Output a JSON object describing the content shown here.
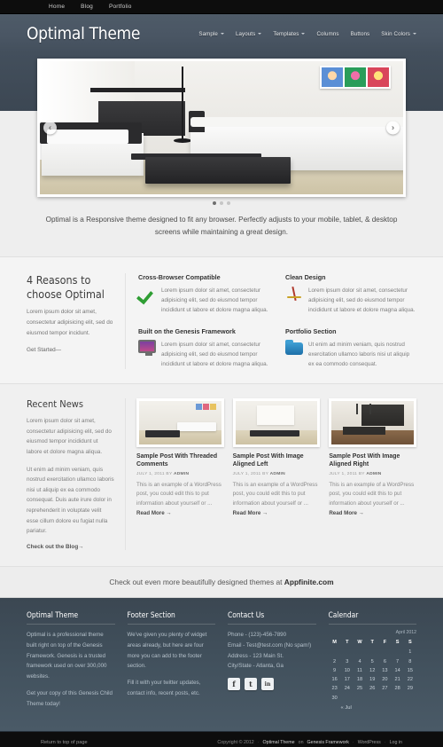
{
  "topbar": {
    "items": [
      {
        "label": "Home"
      },
      {
        "label": "Blog"
      },
      {
        "label": "Portfolio"
      }
    ]
  },
  "header": {
    "site_title": "Optimal Theme",
    "nav": [
      {
        "label": "Sample",
        "has_dropdown": true
      },
      {
        "label": "Layouts",
        "has_dropdown": true
      },
      {
        "label": "Templates",
        "has_dropdown": true
      },
      {
        "label": "Columns",
        "has_dropdown": false
      },
      {
        "label": "Buttons",
        "has_dropdown": false
      },
      {
        "label": "Skin Colors",
        "has_dropdown": true
      }
    ]
  },
  "slider": {
    "prev_icon": "chevron-left-icon",
    "next_icon": "chevron-right-icon",
    "prev_glyph": "‹",
    "next_glyph": "›",
    "slide_count": 3,
    "active_slide": 1
  },
  "tagline": "Optimal is a Responsive theme designed to fit any browser. Perfectly adjusts to your mobile, tablet, & desktop screens while maintaining a great design.",
  "features": {
    "heading": "4 Reasons to choose Optimal",
    "intro": "Lorem ipsum dolor sit amet, consectetur adipisicing elit, sed do eiusmod tempor incidunt.",
    "cta_label": "Get Started—",
    "items": [
      {
        "title": "Cross-Browser Compatible",
        "icon": "green-check-icon",
        "text": "Lorem ipsum dolor sit amet, consectetur adipisicing elit, sed do eiusmod tempor incididunt ut labore et dolore magna aliqua."
      },
      {
        "title": "Clean Design",
        "icon": "easel-icon",
        "text": "Lorem ipsum dolor sit amet, consectetur adipisicing elit, sed do eiusmod tempor incididunt ut labore et dolore magna aliqua."
      },
      {
        "title": "Built on the Genesis Framework",
        "icon": "monitor-icon",
        "text": "Lorem ipsum dolor sit amet, consectetur adipisicing elit, sed do eiusmod tempor incididunt ut labore et dolore magna aliqua."
      },
      {
        "title": "Portfolio Section",
        "icon": "blue-folder-icon",
        "text": "Ut enim ad minim veniam, quis nostrud exercitation ullamco laboris nisi ut aliquip ex ea commodo consequat."
      }
    ]
  },
  "news": {
    "heading": "Recent News",
    "paragraph1": "Lorem ipsum dolor sit amet, consectetur adipisicing elit, sed do eiusmod tempor incididunt ut labore et dolore magna aliqua.",
    "paragraph2": "Ut enim ad minim veniam, quis nostrud exercitation ullamco laboris nisi ut aliquip ex ea commodo consequat. Duis aute irure dolor in reprehenderit in voluptate velit esse cillum dolore eu fugiat nulla pariatur.",
    "blog_link": "Check out the Blog→",
    "posts": [
      {
        "title": "Sample Post With Threaded Comments",
        "date": "JULY 1, 2011 BY",
        "author": "ADMIN",
        "excerpt": "This is an example of a WordPress post, you could edit this to put information about yourself or ...",
        "read_more": "Read More →",
        "thumb": "living-room-thumb"
      },
      {
        "title": "Sample Post With Image Aligned Left",
        "date": "JULY 1, 2011 BY",
        "author": "ADMIN",
        "excerpt": "This is an example of a WordPress post, you could edit this to put information about yourself or ...",
        "read_more": "Read More →",
        "thumb": "lounge-thumb"
      },
      {
        "title": "Sample Post With Image Aligned Right",
        "date": "JULY 1, 2011 BY",
        "author": "ADMIN",
        "excerpt": "This is an example of a WordPress post, you could edit this to put information about yourself or ...",
        "read_more": "Read More →",
        "thumb": "kitchen-thumb"
      }
    ]
  },
  "cta_bar": {
    "text": "Check out even more beautifully designed themes at ",
    "link": "Appfinite.com"
  },
  "footer": {
    "widget1": {
      "title": "Optimal Theme",
      "p1": "Optimal is a professional theme built right on top of the Genesis Framework. Genesis is a trusted framework used on over 300,000 websites.",
      "p2": "Get your copy of this Genesis Child Theme today!"
    },
    "widget2": {
      "title": "Footer Section",
      "p1": "We've given you plenty of widget areas already, but here are four more you can add to the footer section.",
      "p2": "Fill it with your twitter updates, contact info, recent posts, etc."
    },
    "widget3": {
      "title": "Contact Us",
      "lines": [
        "Phone - (123)-456-7890",
        "Email - Test@test.com (No spam!)",
        "Address - 123 Main St.",
        "City/State - Atlanta, Ga"
      ],
      "social": [
        {
          "name": "facebook-icon",
          "glyph": "f"
        },
        {
          "name": "twitter-icon",
          "glyph": "t"
        },
        {
          "name": "linkedin-icon",
          "glyph": "in"
        }
      ]
    },
    "calendar": {
      "title": "Calendar",
      "caption": "April 2012",
      "weekdays": [
        "M",
        "T",
        "W",
        "T",
        "F",
        "S",
        "S"
      ],
      "weeks": [
        [
          "",
          "",
          "",
          "",
          "",
          "",
          "1"
        ],
        [
          "2",
          "3",
          "4",
          "5",
          "6",
          "7",
          "8"
        ],
        [
          "9",
          "10",
          "11",
          "12",
          "13",
          "14",
          "15"
        ],
        [
          "16",
          "17",
          "18",
          "19",
          "20",
          "21",
          "22"
        ],
        [
          "23",
          "24",
          "25",
          "26",
          "27",
          "28",
          "29"
        ],
        [
          "30",
          "",
          "",
          "",
          "",
          "",
          ""
        ]
      ],
      "prev_link": "« Jul"
    }
  },
  "bottombar": {
    "return_top": "Return to top of page",
    "copyright": "Copyright © 2012",
    "theme": "Optimal Theme",
    "on": "on",
    "framework": "Genesis Framework",
    "wordpress": "WordPress",
    "login": "Log in",
    "separator": "·"
  },
  "colors": {
    "header_blue": "#4a5664",
    "topbar_black": "#0d0d0d",
    "check_green": "#2f9e34",
    "folder_blue": "#3f9fd4",
    "footer_slate": "#41505c"
  }
}
